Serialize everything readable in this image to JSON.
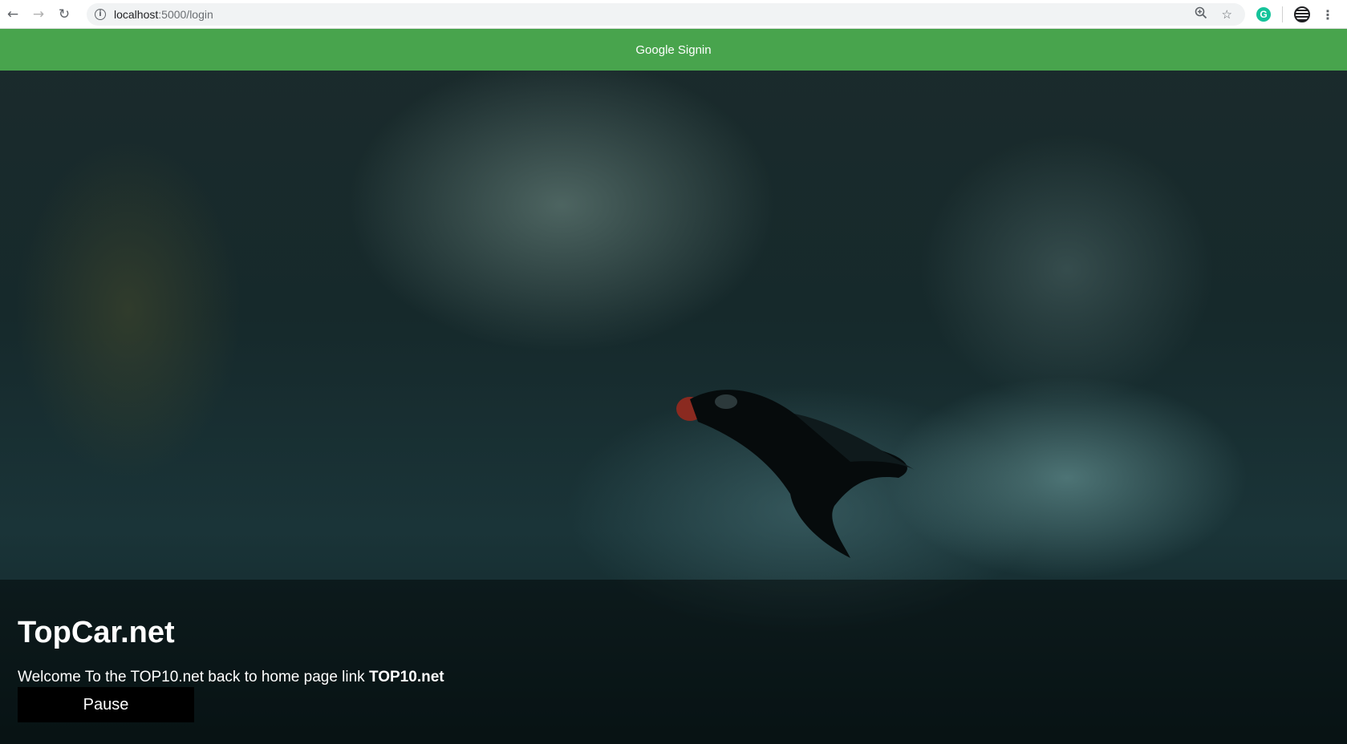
{
  "browser": {
    "url_host": "localhost",
    "url_path": ":5000/login",
    "back_icon": "arrow-left-icon",
    "forward_icon": "arrow-right-icon",
    "reload_icon": "reload-icon",
    "zoom_icon": "zoom-icon",
    "bookmark_icon": "star-icon",
    "extension_icon": "grammarly-icon",
    "profile_icon": "profile-icon",
    "menu_icon": "kebab-menu-icon"
  },
  "header": {
    "signin_label": "Google Signin",
    "background_color": "#4caf50"
  },
  "hero": {
    "title": "TopCar.net",
    "welcome_text": "Welcome To the TOP10.net back to home page link ",
    "welcome_link": "TOP10.net",
    "pause_label": "Pause"
  }
}
